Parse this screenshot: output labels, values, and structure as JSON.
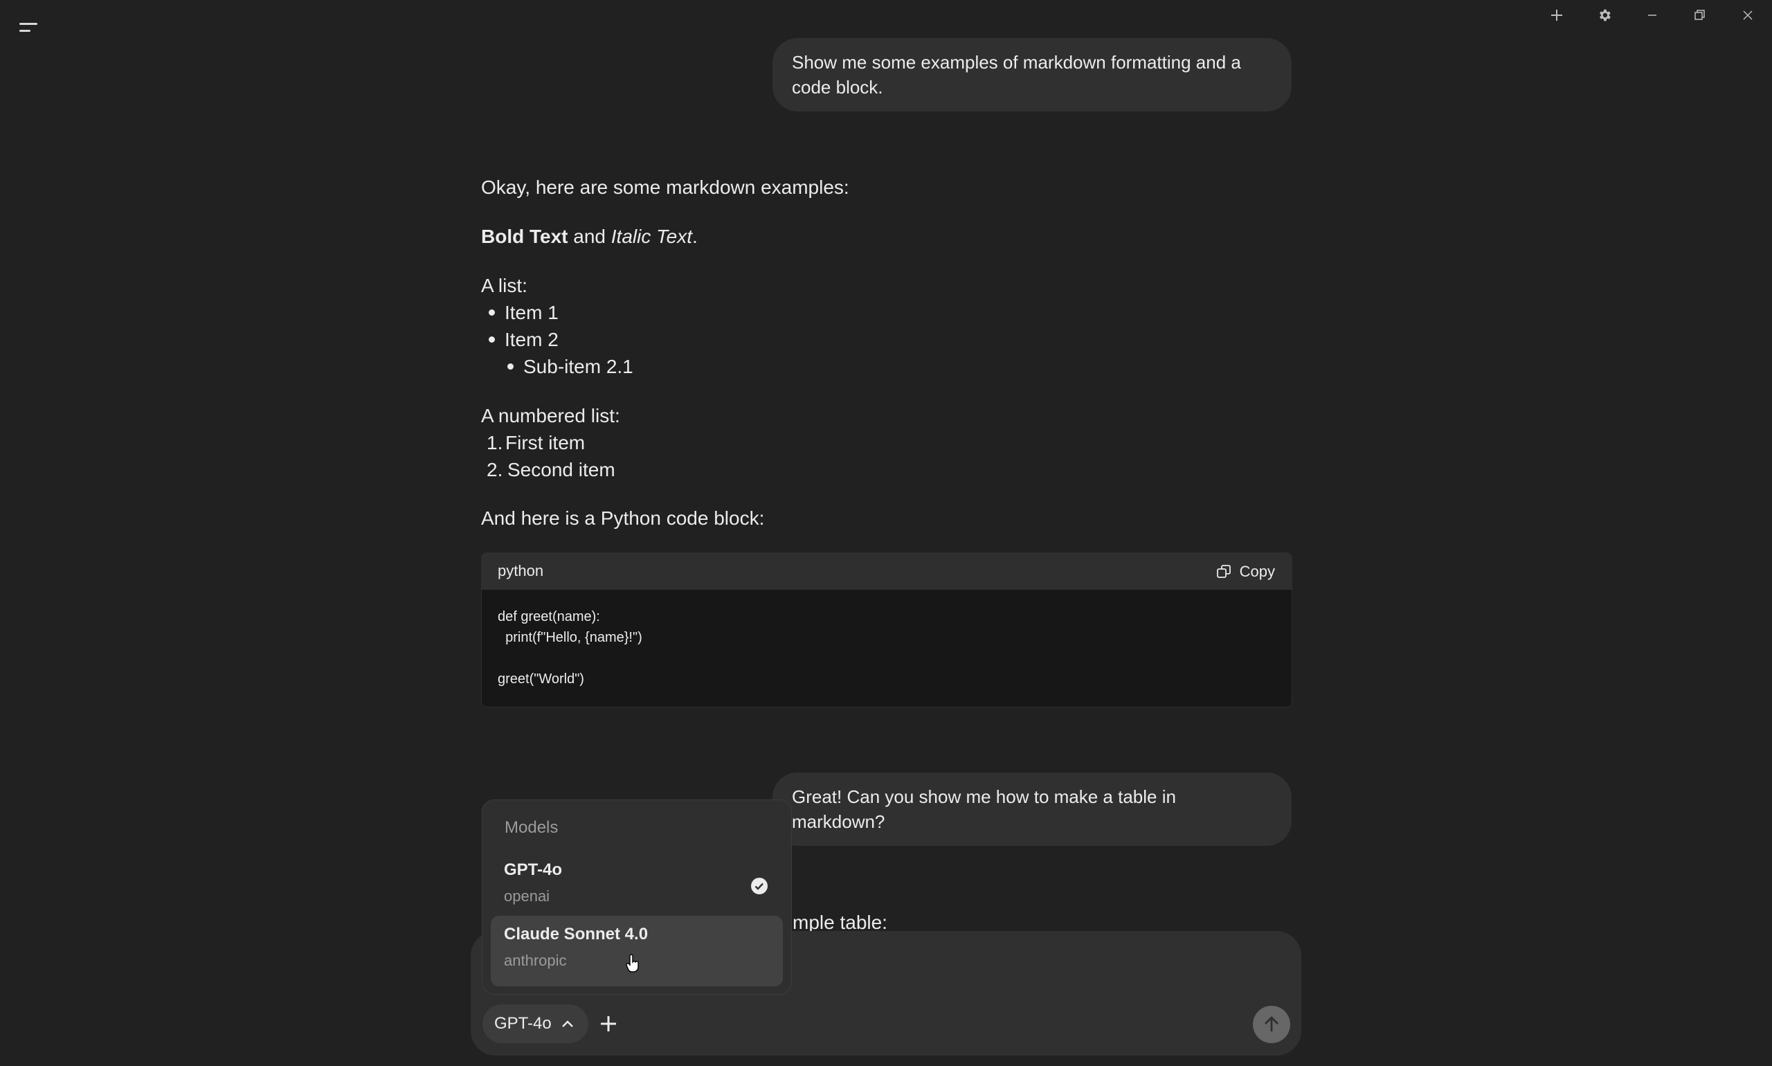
{
  "window": {
    "controls": [
      "new-chat",
      "settings",
      "minimize",
      "restore",
      "close"
    ]
  },
  "messages": {
    "user_1": "Show me some examples of markdown formatting and a code block.",
    "assistant_1": {
      "intro": "Okay, here are some markdown examples:",
      "bold": "Bold Text",
      "and": "and",
      "italic": "Italic Text",
      "period": ".",
      "list_title": "A list:",
      "list_items": [
        "Item 1",
        "Item 2"
      ],
      "sub_item": "Sub-item 2.1",
      "numbered_title": "A numbered list:",
      "numbered_items": [
        {
          "num": "1.",
          "text": "First item"
        },
        {
          "num": "2.",
          "text": "Second item"
        }
      ],
      "code_intro": "And here is a Python code block:",
      "code": {
        "language": "python",
        "copy_label": "Copy",
        "lines": [
          "def greet(name):",
          "  print(f\"Hello, {name}!\")",
          "",
          "greet(\"World\")"
        ]
      }
    },
    "user_2": "Great! Can you show me how to make a table in markdown?",
    "assistant_2_partial": "mple table:"
  },
  "model_menu": {
    "title": "Models",
    "options": [
      {
        "name": "GPT-4o",
        "provider": "openai",
        "selected": true
      },
      {
        "name": "Claude Sonnet 4.0",
        "provider": "anthropic",
        "selected": false
      }
    ]
  },
  "composer": {
    "model_label": "GPT-4o",
    "icons": [
      "chevron-up-icon",
      "plus-icon",
      "arrow-up-icon"
    ]
  }
}
